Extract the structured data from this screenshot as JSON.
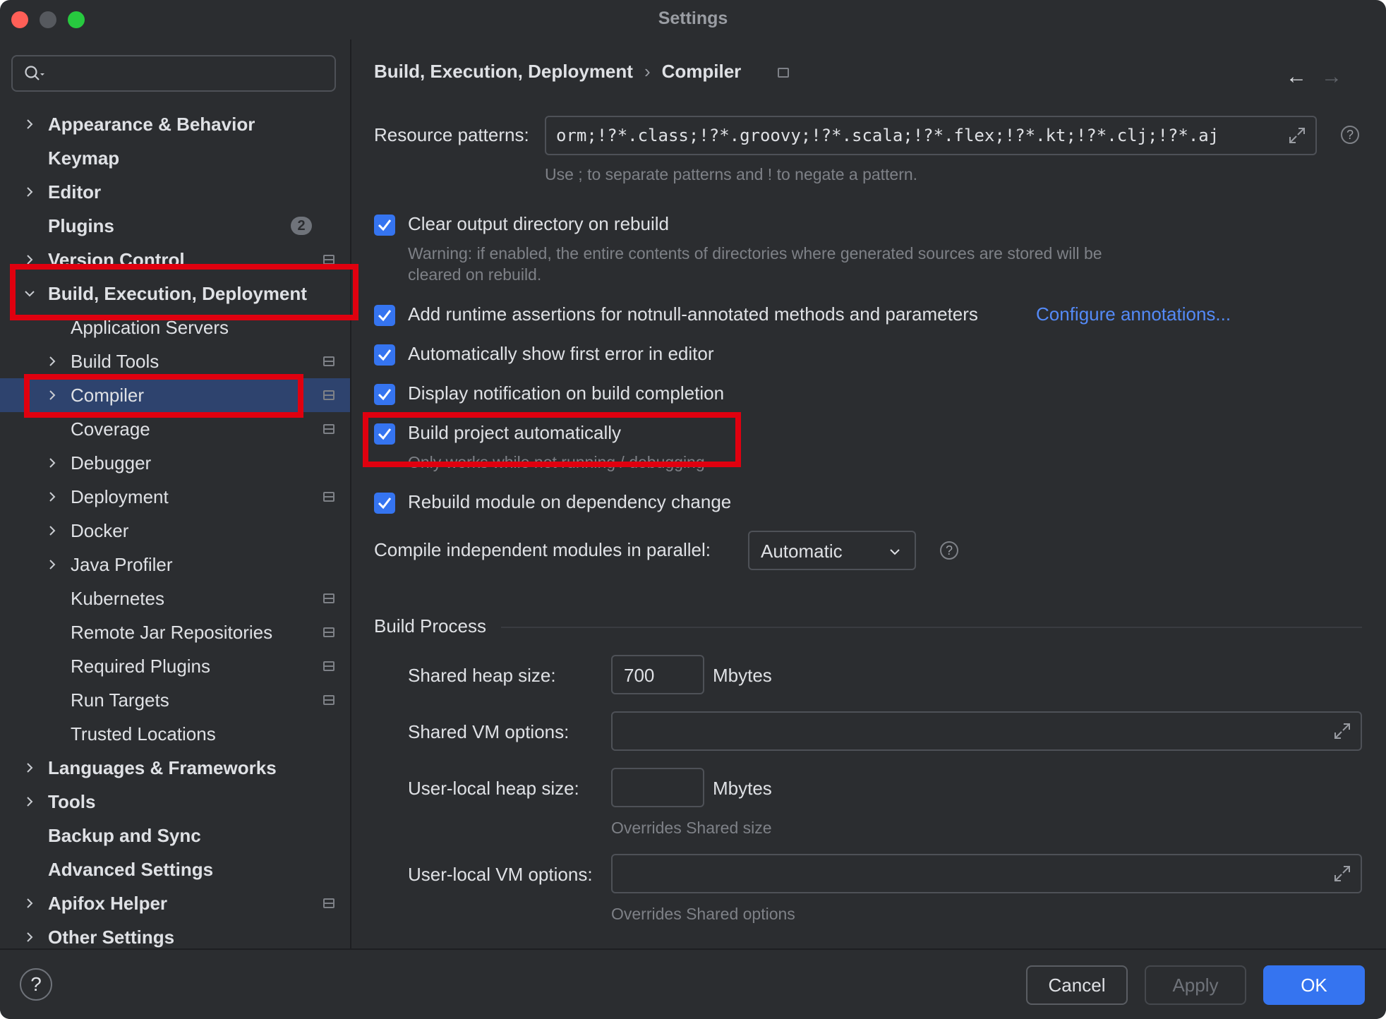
{
  "window": {
    "title": "Settings"
  },
  "search": {
    "placeholder": ""
  },
  "tree": [
    {
      "label": "Appearance & Behavior",
      "level": 0,
      "chevron": "right"
    },
    {
      "label": "Keymap",
      "level": 0
    },
    {
      "label": "Editor",
      "level": 0,
      "chevron": "right"
    },
    {
      "label": "Plugins",
      "level": 0,
      "badge": "2"
    },
    {
      "label": "Version Control",
      "level": 0,
      "chevron": "right",
      "pin": true
    },
    {
      "label": "Build, Execution, Deployment",
      "level": 0,
      "chevron": "down"
    },
    {
      "label": "Application Servers",
      "level": 1
    },
    {
      "label": "Build Tools",
      "level": 1,
      "chevron": "right",
      "pin": true
    },
    {
      "label": "Compiler",
      "level": 1,
      "chevron": "right",
      "pin": true,
      "selected": true
    },
    {
      "label": "Coverage",
      "level": 1,
      "pin": true
    },
    {
      "label": "Debugger",
      "level": 1,
      "chevron": "right"
    },
    {
      "label": "Deployment",
      "level": 1,
      "chevron": "right",
      "pin": true
    },
    {
      "label": "Docker",
      "level": 1,
      "chevron": "right"
    },
    {
      "label": "Java Profiler",
      "level": 1,
      "chevron": "right"
    },
    {
      "label": "Kubernetes",
      "level": 1,
      "pin": true
    },
    {
      "label": "Remote Jar Repositories",
      "level": 1,
      "pin": true
    },
    {
      "label": "Required Plugins",
      "level": 1,
      "pin": true
    },
    {
      "label": "Run Targets",
      "level": 1,
      "pin": true
    },
    {
      "label": "Trusted Locations",
      "level": 1
    },
    {
      "label": "Languages & Frameworks",
      "level": 0,
      "chevron": "right"
    },
    {
      "label": "Tools",
      "level": 0,
      "chevron": "right"
    },
    {
      "label": "Backup and Sync",
      "level": 0
    },
    {
      "label": "Advanced Settings",
      "level": 0
    },
    {
      "label": "Apifox Helper",
      "level": 0,
      "chevron": "right",
      "pin": true
    },
    {
      "label": "Other Settings",
      "level": 0,
      "chevron": "right"
    }
  ],
  "breadcrumb": {
    "parent": "Build, Execution, Deployment",
    "separator": "›",
    "current": "Compiler"
  },
  "nav": {
    "back": "←",
    "forward": "→"
  },
  "resource": {
    "label": "Resource patterns:",
    "value": "orm;!?*.class;!?*.groovy;!?*.scala;!?*.flex;!?*.kt;!?*.clj;!?*.aj",
    "hint": "Use ; to separate patterns and ! to negate a pattern."
  },
  "options": {
    "clear_output": {
      "label": "Clear output directory on rebuild",
      "checked": true
    },
    "clear_output_warning_1": "Warning: if enabled, the entire contents of directories where generated sources are stored will be",
    "clear_output_warning_2": "cleared on rebuild.",
    "runtime_assertions": {
      "label": "Add runtime assertions for notnull-annotated methods and parameters",
      "checked": true
    },
    "configure_annotations": "Configure annotations...",
    "show_first_error": {
      "label": "Automatically show first error in editor",
      "checked": true
    },
    "notify_build": {
      "label": "Display notification on build completion",
      "checked": true
    },
    "build_auto": {
      "label": "Build project automatically",
      "checked": true
    },
    "build_auto_hint": "Only works while not running / debugging",
    "rebuild_module": {
      "label": "Rebuild module on dependency change",
      "checked": true
    }
  },
  "parallel": {
    "label": "Compile independent modules in parallel:",
    "value": "Automatic"
  },
  "build_process": {
    "title": "Build Process",
    "shared_heap_label": "Shared heap size:",
    "shared_heap_value": "700",
    "mbytes": "Mbytes",
    "shared_vm_label": "Shared VM options:",
    "shared_vm_value": "",
    "local_heap_label": "User-local heap size:",
    "local_heap_value": "",
    "local_heap_hint": "Overrides Shared size",
    "local_vm_label": "User-local VM options:",
    "local_vm_value": "",
    "local_vm_hint": "Overrides Shared options"
  },
  "footer": {
    "help": "?",
    "cancel": "Cancel",
    "apply": "Apply",
    "ok": "OK"
  },
  "colors": {
    "accent": "#3574f0",
    "link": "#548af7",
    "highlight": "#e0000f",
    "selection": "#2e436e"
  }
}
